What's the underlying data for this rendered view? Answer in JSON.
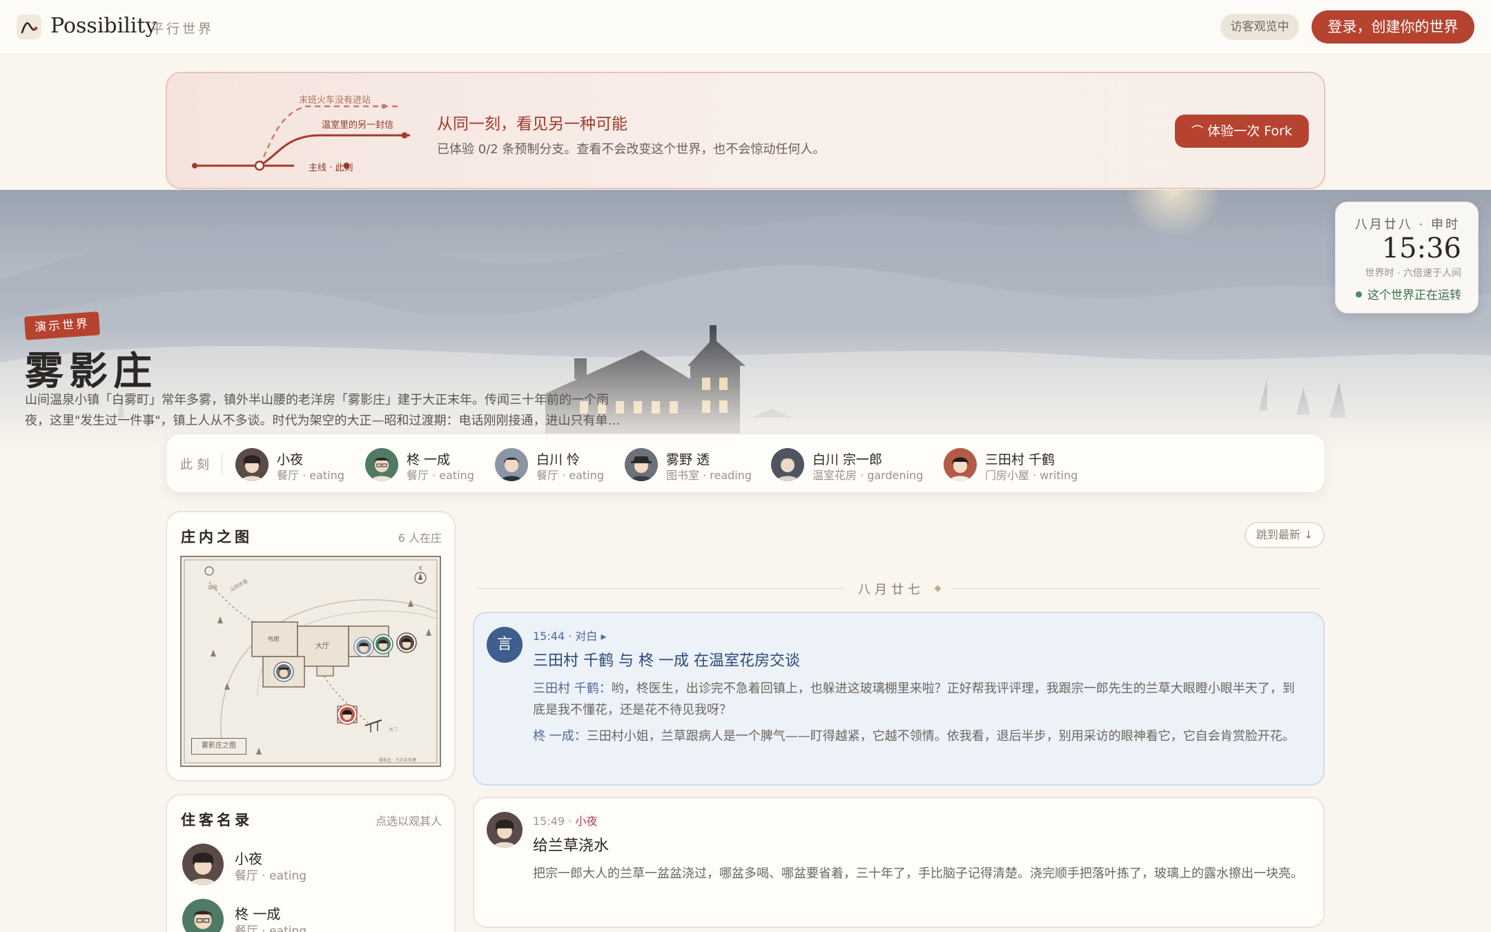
{
  "header": {
    "brand": "Possibility",
    "brand_sub": "平行世界",
    "guest_badge": "访客观览中",
    "login_label": "登录，创建你的世界"
  },
  "fork_banner": {
    "branch_top": "末班火车没有进站",
    "branch_mid": "温室里的另一封信",
    "branch_main": "主线 · 此刻",
    "title": "从同一刻，看见另一种可能",
    "text": "已体验 0/2 条预制分支。查看不会改变这个世界，也不会惊动任何人。",
    "button": "体验一次 Fork"
  },
  "world": {
    "tag": "演示世界",
    "title": "雾影庄",
    "desc": "山间温泉小镇「白雾町」常年多雾，镇外半山腰的老洋房「雾影庄」建于大正末年。传闻三十年前的一个雨夜，这里\"发生过一件事\"，镇上人从不多谈。时代为架空的大正—昭和过渡期：电话刚刚接通，进山只有单…"
  },
  "clock": {
    "date": "八月廿八 · 申时",
    "time": "15:36",
    "sub": "世界时 · 六倍速于人间",
    "status": "这个世界正在运转"
  },
  "now": {
    "label": "此刻",
    "people": [
      {
        "name": "小夜",
        "activity": "餐厅 · eating"
      },
      {
        "name": "柊 一成",
        "activity": "餐厅 · eating"
      },
      {
        "name": "白川 怜",
        "activity": "餐厅 · eating"
      },
      {
        "name": "雾野 透",
        "activity": "图书室 · reading"
      },
      {
        "name": "白川 宗一郎",
        "activity": "温室花房 · gardening"
      },
      {
        "name": "三田村 千鹤",
        "activity": "门房小屋 · writing"
      }
    ]
  },
  "map": {
    "title": "庄内之图",
    "count": "6 人在庄",
    "legend": "雾影庄之图",
    "room_study": "书房",
    "room_hall": "大厅"
  },
  "residents": {
    "title": "住客名录",
    "hint": "点选以观其人",
    "list": [
      {
        "name": "小夜",
        "activity": "餐厅 · eating"
      },
      {
        "name": "柊 一成",
        "activity": "餐厅 · eating"
      }
    ]
  },
  "timeline": {
    "jump_label": "跳到最新 ↓",
    "day": "八月廿七",
    "events": [
      {
        "badge": "言",
        "time": "15:44 · 对白 ▸",
        "title": "三田村 千鹤 与 柊 一成 在温室花房交谈",
        "lines": [
          {
            "speaker": "三田村 千鹤：",
            "text": "哟，柊医生，出诊完不急着回镇上，也躲进这玻璃棚里来啦？正好帮我评评理，我跟宗一郎先生的兰草大眼瞪小眼半天了，到底是我不懂花，还是花不待见我呀？"
          },
          {
            "speaker": "柊 一成：",
            "text": "三田村小姐，兰草跟病人是一个脾气——盯得越紧，它越不领情。依我看，退后半步，别用采访的眼神看它，它自会肯赏脸开花。"
          }
        ]
      },
      {
        "time": "15:49 · ",
        "actor": "小夜",
        "title": "给兰草浇水",
        "text": "把宗一郎大人的兰草一盆盆浇过，哪盆多喝、哪盆要省着，三十年了，手比脑子记得清楚。浇完顺手把落叶拣了，玻璃上的露水擦出一块亮。"
      }
    ]
  },
  "colors": {
    "accent": "#b54330",
    "dialogue_blue": "#3e5e8e",
    "status_green": "#4e8a62"
  }
}
